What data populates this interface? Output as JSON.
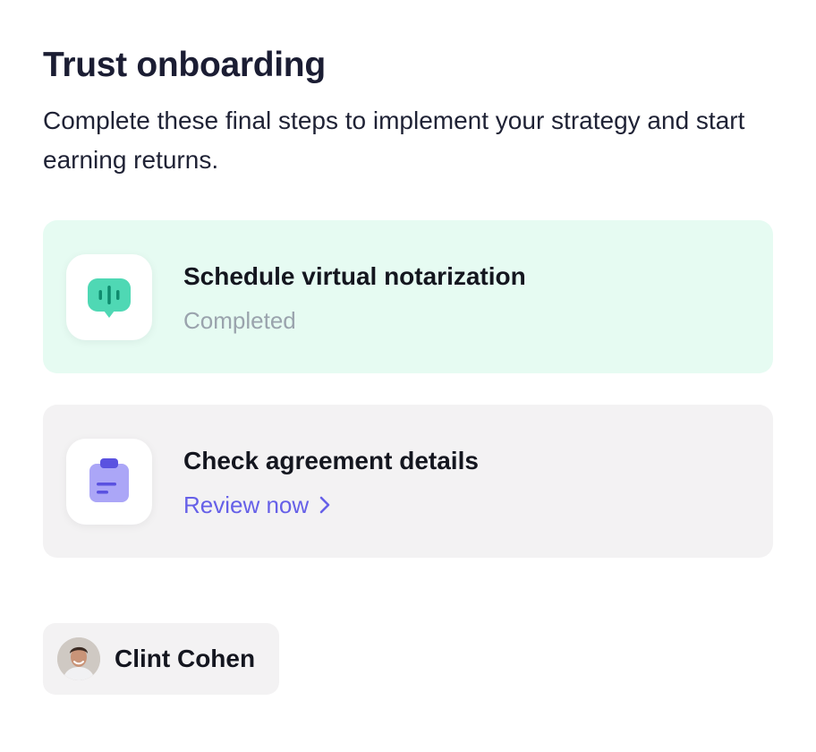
{
  "header": {
    "title": "Trust onboarding",
    "subtitle": "Complete these final steps to implement your strategy and start earning returns."
  },
  "steps": [
    {
      "title": "Schedule virtual notarization",
      "status": "Completed",
      "icon": "chat-bubble-waveform-icon",
      "accent_color": "#4fd8b4",
      "background_color": "#e6fbf2"
    },
    {
      "title": "Check agreement details",
      "action_label": "Review now",
      "icon": "clipboard-icon",
      "accent_color": "#8c86f4",
      "background_color": "#f3f2f3"
    }
  ],
  "user": {
    "name": "Clint Cohen"
  },
  "colors": {
    "link": "#6660e8",
    "muted_text": "#9aa3ad"
  }
}
